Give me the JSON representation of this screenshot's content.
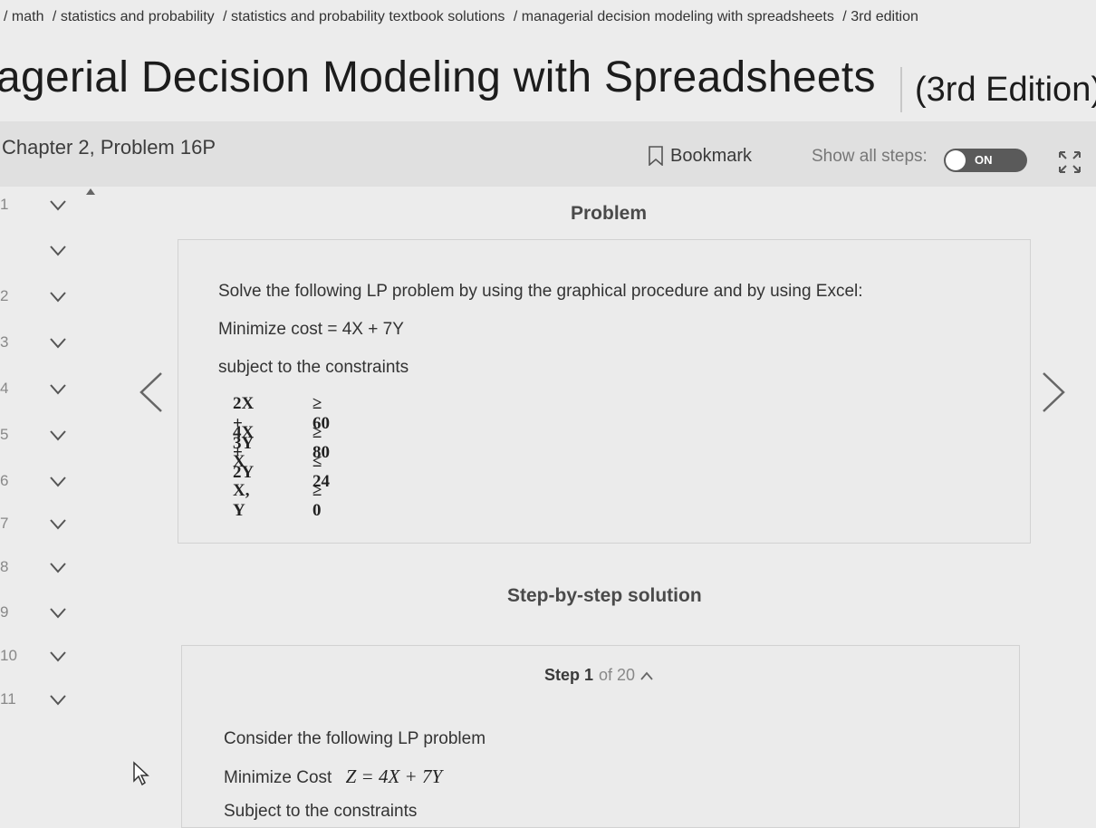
{
  "breadcrumb": {
    "items": [
      "/ math",
      "/ statistics and probability",
      "/ statistics and probability textbook solutions",
      "/ managerial decision modeling with spreadsheets",
      "/ 3rd edition"
    ]
  },
  "book": {
    "title": "agerial Decision Modeling with Spreadsheets",
    "edition": "(3rd Edition)"
  },
  "chapter": {
    "label": "Chapter 2, Problem 16P",
    "bookmark_label": "Bookmark",
    "show_steps_label": "Show all steps:",
    "toggle_state": "ON"
  },
  "sidebar": {
    "items": [
      {
        "num": "1"
      },
      {
        "num": ""
      },
      {
        "num": "2"
      },
      {
        "num": "3"
      },
      {
        "num": "4"
      },
      {
        "num": "5"
      },
      {
        "num": "6"
      },
      {
        "num": "7"
      },
      {
        "num": "8"
      },
      {
        "num": "9"
      },
      {
        "num": "10"
      },
      {
        "num": "11"
      }
    ]
  },
  "problem": {
    "heading": "Problem",
    "intro": "Solve the following LP problem by using the graphical procedure and by using Excel:",
    "objective": "Minimize cost = 4X + 7Y",
    "subject": "subject to the constraints",
    "constraints": [
      {
        "lhs": "2X + 3Y",
        "rhs": "≥ 60"
      },
      {
        "lhs": "4X + 2Y",
        "rhs": "≥ 80"
      },
      {
        "lhs": "X",
        "rhs": "≤ 24"
      },
      {
        "lhs": "X, Y",
        "rhs": "≥  0"
      }
    ]
  },
  "solution": {
    "heading": "Step-by-step solution",
    "step_word": "Step 1",
    "step_of": "of 20",
    "line1": "Consider the following LP problem",
    "line2_label": "Minimize Cost",
    "line2_math": "Z = 4X + 7Y",
    "line3": "Subject to the constraints"
  },
  "colors": {
    "toggle_bg": "#5a5a5a",
    "page_bg": "#ececec",
    "chapter_bar_bg": "#e0e0e0"
  },
  "icons": [
    "bookmark-icon",
    "expand-icon",
    "chevron-down-icon",
    "chevron-left-icon",
    "chevron-right-icon",
    "chevron-up-icon",
    "cursor-icon"
  ]
}
